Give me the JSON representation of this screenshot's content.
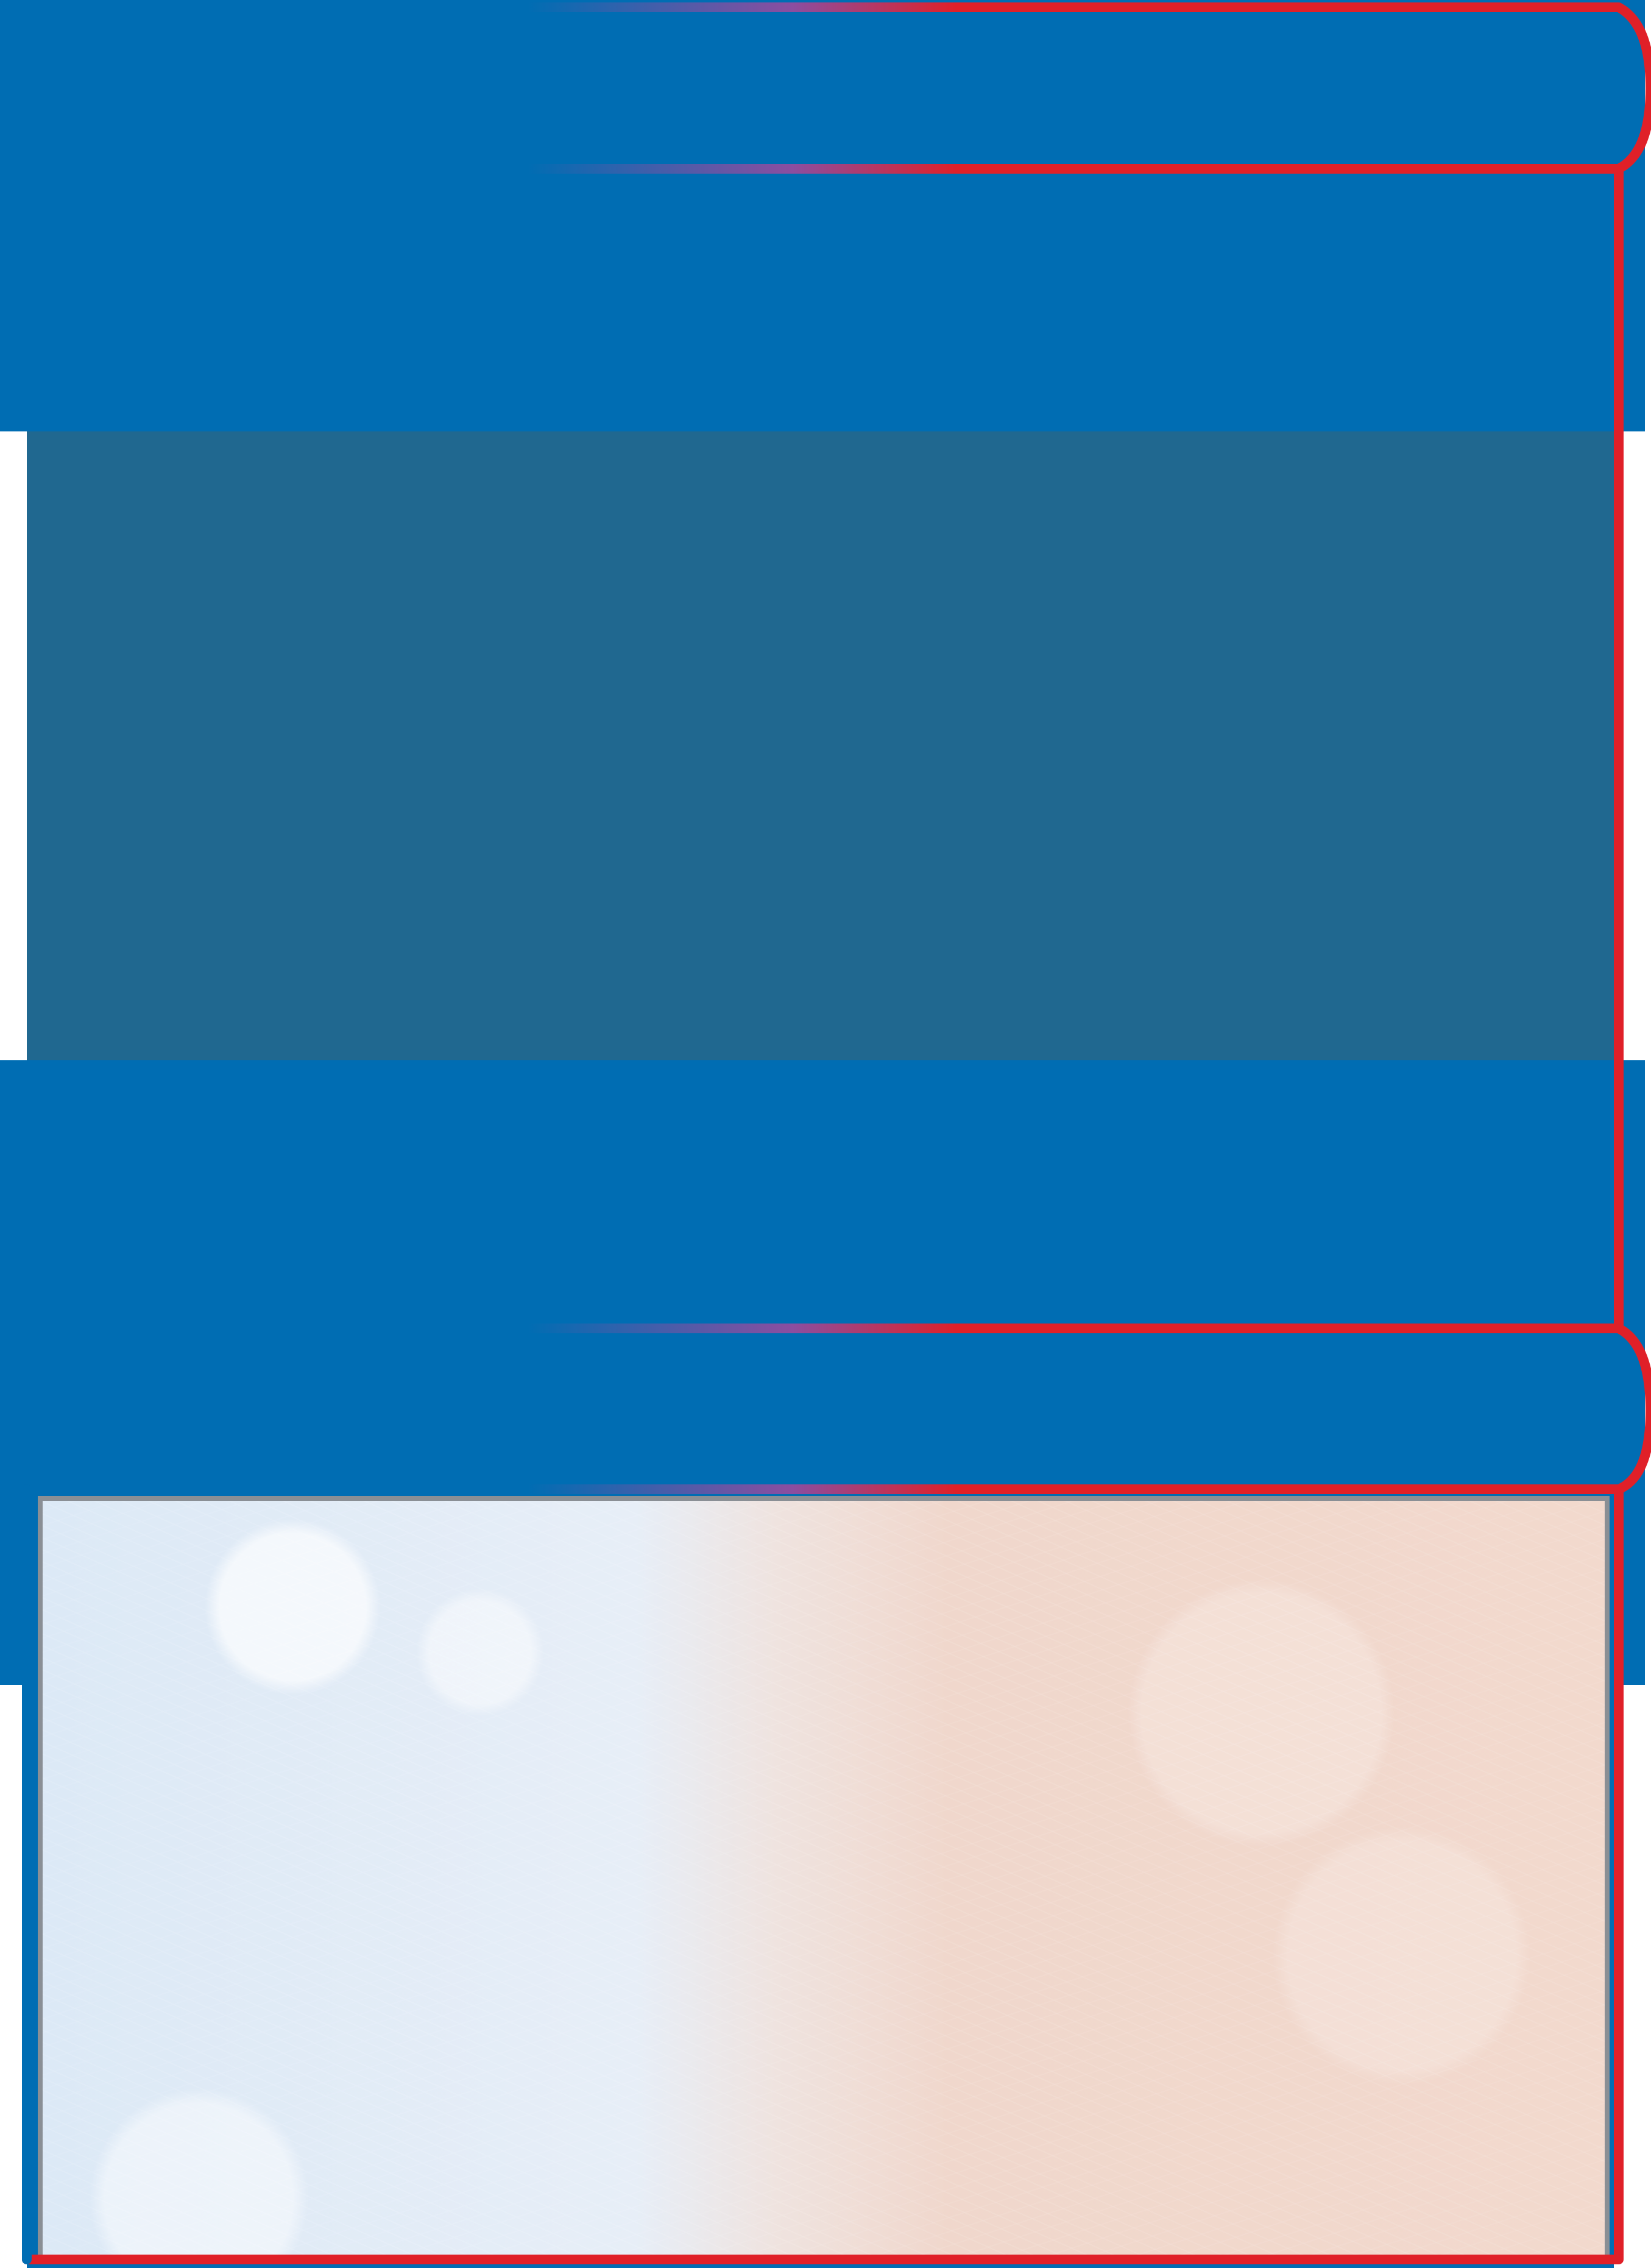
{
  "colors": {
    "blue": "#006db3",
    "dark_blue": "#206890",
    "red": "#e02028",
    "panel_border": "#8a8f95"
  },
  "shapes": {
    "top_tab": "rounded-banner",
    "middle_tab": "rounded-banner",
    "lower_panel": "textured-panel"
  }
}
